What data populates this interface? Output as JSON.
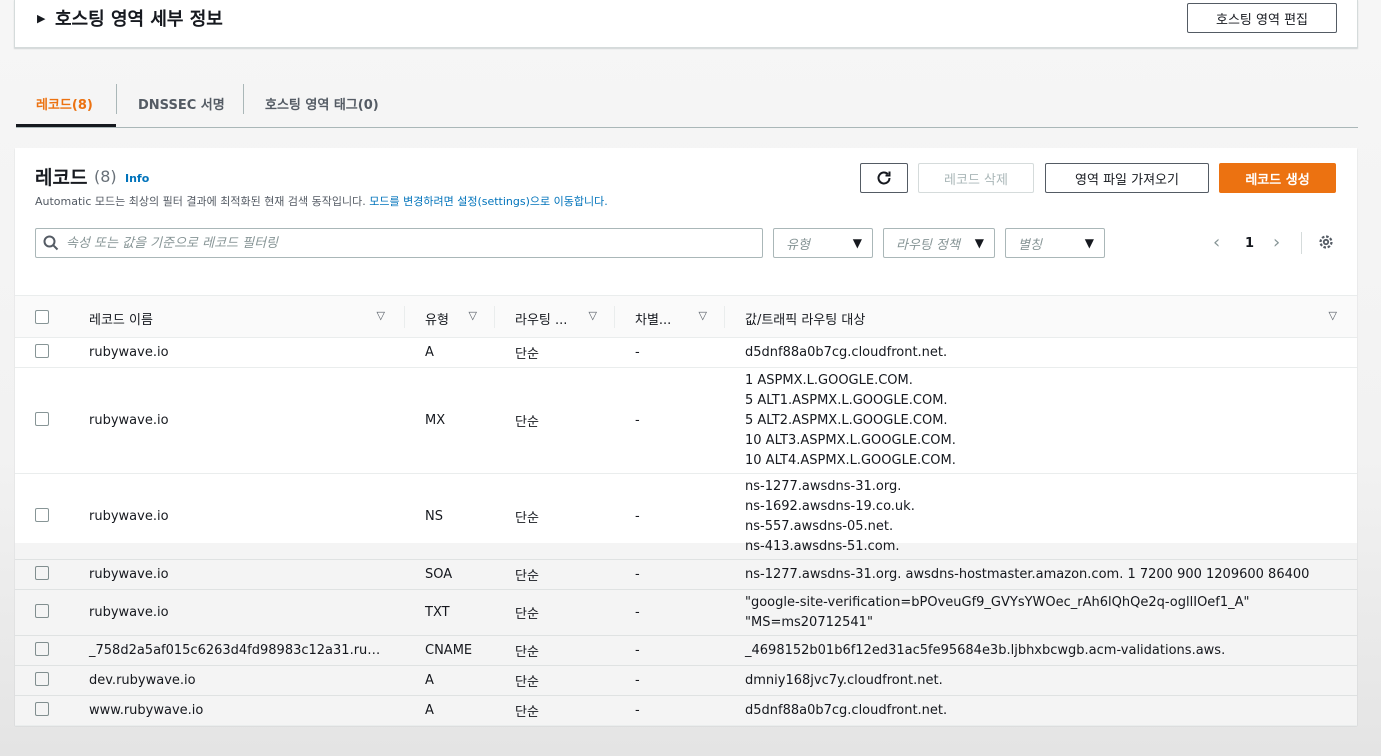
{
  "hosted_zone": {
    "details_title": "호스팅 영역 세부 정보",
    "edit_button": "호스팅 영역 편집"
  },
  "tabs": [
    {
      "label": "레코드(8)",
      "active": true
    },
    {
      "label": "DNSSEC 서명",
      "active": false
    },
    {
      "label": "호스팅 영역 태그(0)",
      "active": false
    }
  ],
  "records": {
    "title": "레코드",
    "count": "(8)",
    "info": "Info",
    "description": "Automatic 모드는 최상의 필터 결과에 최적화된 현재 검색 동작입니다.",
    "description_link": "모드를 변경하려면 설정(settings)으로 이동합니다.",
    "delete_button": "레코드 삭제",
    "import_button": "영역 파일 가져오기",
    "create_button": "레코드 생성",
    "search_placeholder": "속성 또는 값을 기준으로 레코드 필터링",
    "filter_type": "유형",
    "filter_routing": "라우팅 정책",
    "filter_alias": "별칭",
    "page": "1",
    "columns": {
      "name": "레코드 이름",
      "type": "유형",
      "routing": "라우팅 ...",
      "diff": "차별...",
      "value": "값/트래픽 라우팅 대상"
    },
    "rows": [
      {
        "name": "rubywave.io",
        "type": "A",
        "routing": "단순",
        "diff": "-",
        "value": [
          "d5dnf88a0b7cg.cloudfront.net."
        ]
      },
      {
        "name": "rubywave.io",
        "type": "MX",
        "routing": "단순",
        "diff": "-",
        "value": [
          "1 ASPMX.L.GOOGLE.COM.",
          "5 ALT1.ASPMX.L.GOOGLE.COM.",
          "5 ALT2.ASPMX.L.GOOGLE.COM.",
          "10 ALT3.ASPMX.L.GOOGLE.COM.",
          "10 ALT4.ASPMX.L.GOOGLE.COM."
        ]
      },
      {
        "name": "rubywave.io",
        "type": "NS",
        "routing": "단순",
        "diff": "-",
        "value": [
          "ns-1277.awsdns-31.org.",
          "ns-1692.awsdns-19.co.uk.",
          "ns-557.awsdns-05.net.",
          "ns-413.awsdns-51.com."
        ]
      },
      {
        "name": "rubywave.io",
        "type": "SOA",
        "routing": "단순",
        "diff": "-",
        "value": [
          "ns-1277.awsdns-31.org. awsdns-hostmaster.amazon.com. 1 7200 900 1209600 86400"
        ]
      },
      {
        "name": "rubywave.io",
        "type": "TXT",
        "routing": "단순",
        "diff": "-",
        "value": [
          "\"google-site-verification=bPOveuGf9_GVYsYWOec_rAh6lQhQe2q-ogllIOef1_A\"",
          "\"MS=ms20712541\""
        ]
      },
      {
        "name": "_758d2a5af015c6263d4fd98983c12a31.ru…",
        "type": "CNAME",
        "routing": "단순",
        "diff": "-",
        "value": [
          "_4698152b01b6f12ed31ac5fe95684e3b.ljbhxbcwgb.acm-validations.aws."
        ]
      },
      {
        "name": "dev.rubywave.io",
        "type": "A",
        "routing": "단순",
        "diff": "-",
        "value": [
          "dmniy168jvc7y.cloudfront.net."
        ]
      },
      {
        "name": "www.rubywave.io",
        "type": "A",
        "routing": "단순",
        "diff": "-",
        "value": [
          "d5dnf88a0b7cg.cloudfront.net."
        ]
      }
    ]
  },
  "colors": {
    "accent": "#ec7211",
    "link": "#0073bb"
  }
}
